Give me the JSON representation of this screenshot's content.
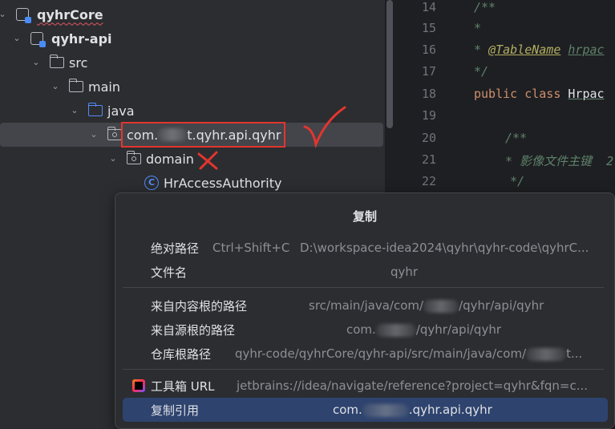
{
  "tree": {
    "items": [
      {
        "label": "qyhrCore"
      },
      {
        "label": "qyhr-api"
      },
      {
        "label": "src"
      },
      {
        "label": "main"
      },
      {
        "label": "java"
      },
      {
        "label_prefix": "com.",
        "label_suffix": "t.qyhr.api.qyhr"
      },
      {
        "label": "domain"
      },
      {
        "label": "HrAccessAuthority",
        "icon_letter": "C"
      }
    ],
    "annotations": {
      "check": "checkmark",
      "cross": "cross-mark"
    }
  },
  "editor": {
    "lines": [
      {
        "num": "14",
        "text": "/**"
      },
      {
        "num": "15",
        "text": "*"
      },
      {
        "num": "16",
        "ann": "@TableName",
        "rest": "hrpac"
      },
      {
        "num": "17",
        "text": "*/"
      },
      {
        "num": "18",
        "kw": "public class",
        "cls": "Hrpac"
      },
      {
        "num": "19",
        "text": ""
      },
      {
        "num": "20",
        "text": "/**"
      },
      {
        "num": "21",
        "text": "* 影像文件主键  2"
      },
      {
        "num": "22",
        "text": "*/"
      }
    ]
  },
  "popup": {
    "title": "复制",
    "items": [
      {
        "label": "绝对路径",
        "shortcut": "Ctrl+Shift+C",
        "value": "D:\\workspace-idea2024\\qyhr\\qyhr-code\\qyhrC..."
      },
      {
        "label": "文件名",
        "value": "qyhr"
      },
      {
        "label": "来自内容根的路径",
        "value_prefix": "src/main/java/com/",
        "value_suffix": "/qyhr/api/qyhr"
      },
      {
        "label": "来自源根的路径",
        "value_prefix": "com.",
        "value_suffix": "/qyhr/api/qyhr"
      },
      {
        "label": "仓库根路径",
        "value_prefix": "qyhr-code/qyhrCore/qyhr-api/src/main/java/com/",
        "value_suffix": "t..."
      },
      {
        "label": "工具箱 URL",
        "value": "jetbrains://idea/navigate/reference?project=qyhr&fqn=c..."
      },
      {
        "label": "复制引用",
        "value_prefix": "com.",
        "value_suffix": ".qyhr.api.qyhr"
      }
    ]
  },
  "colors": {
    "accent": "#2e436e",
    "annotation_red": "#e2352f",
    "folder_blue": "#548af7"
  }
}
